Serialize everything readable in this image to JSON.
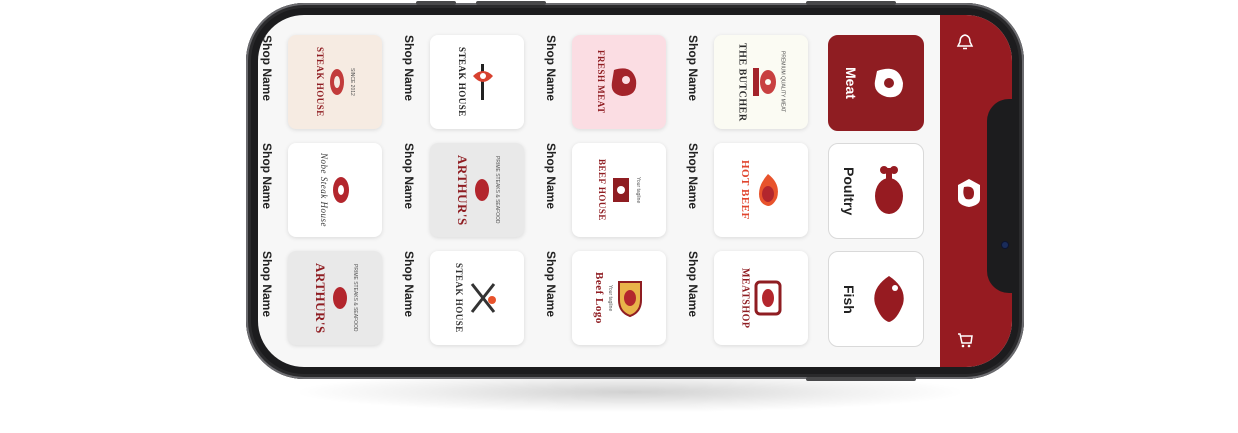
{
  "app": {
    "sidebar": {
      "bell_icon": "bell-icon",
      "logo_icon": "meat-brand-logo-icon",
      "cart_icon": "cart-icon"
    },
    "categories": [
      {
        "label": "Meat",
        "icon": "steak-icon",
        "active": true
      },
      {
        "label": "Poultry",
        "icon": "drumstick-icon",
        "active": false
      },
      {
        "label": "Fish",
        "icon": "fish-icon",
        "active": false
      }
    ],
    "shops": {
      "label": "Shop Name",
      "row1": [
        {
          "logo": "THE BUTCHER",
          "sub": "PREMIUM QUALITY MEAT"
        },
        {
          "logo": "FRESH MEAT",
          "sub": ""
        },
        {
          "logo": "STEAK HOUSE",
          "sub": ""
        },
        {
          "logo": "STEAK HOUSE",
          "sub": "SINCE 2012"
        }
      ],
      "row2": [
        {
          "logo": "HOT BEEF",
          "sub": ""
        },
        {
          "logo": "BEEF HOUSE",
          "sub": "Your tagline"
        },
        {
          "logo": "ARTHUR'S",
          "sub": "PRIME STEAKS & SEAFOOD"
        },
        {
          "logo": "Nobe Steak House",
          "sub": ""
        }
      ],
      "row3": [
        {
          "logo": "MEATSHOP",
          "sub": ""
        },
        {
          "logo": "Beef Logo",
          "sub": "Your tagline"
        },
        {
          "logo": "STEAK HOUSE",
          "sub": ""
        },
        {
          "logo": "ARTHUR'S",
          "sub": "PRIME STEAKS & SEAFOOD"
        }
      ]
    },
    "colors": {
      "brand": "#961b21",
      "accent": "#8f1d22",
      "background": "#f7f7f7",
      "card": "#ffffff"
    }
  }
}
